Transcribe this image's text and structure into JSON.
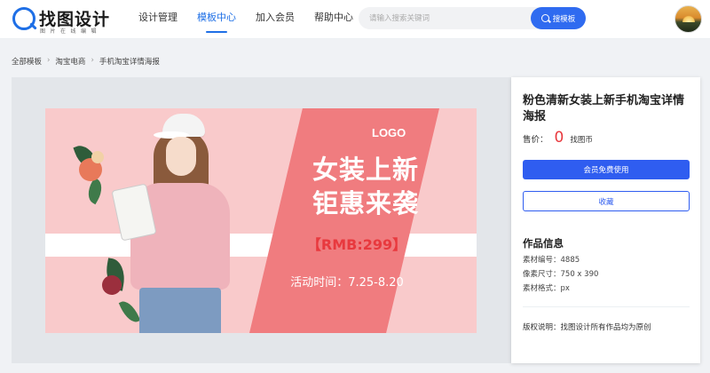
{
  "header": {
    "logo_text": "找图设计",
    "logo_sub": "图片在线编辑",
    "nav": [
      {
        "label": "设计管理",
        "active": false
      },
      {
        "label": "模板中心",
        "active": true
      },
      {
        "label": "加入会员",
        "active": false
      },
      {
        "label": "帮助中心",
        "active": false
      }
    ],
    "search": {
      "placeholder": "请输入搜索关键词",
      "button_label": "搜模板"
    }
  },
  "breadcrumb": [
    "全部模板",
    "淘宝电商",
    "手机淘宝详情海报"
  ],
  "poster": {
    "logo": "LOGO",
    "title_line1": "女装上新",
    "title_line2": "钜惠来袭",
    "price": "【RMB:299】",
    "date": "活动时间：7.25-8.20"
  },
  "panel": {
    "title": "粉色清新女装上新手机淘宝详情海报",
    "price_label": "售价：",
    "price_value": "0",
    "price_unit": "找图币",
    "primary_button": "会员免费使用",
    "secondary_button": "收藏",
    "info_title": "作品信息",
    "info": [
      "素材编号：4885",
      "像素尺寸：750 x 390",
      "素材格式：px"
    ],
    "copyright": "版权说明：找图设计所有作品均为原创"
  },
  "colors": {
    "accent": "#1e6fe6",
    "button": "#2f5df0",
    "price": "#e8393e",
    "poster_bg": "#f9cacb",
    "poster_slant": "#f07c7f"
  }
}
